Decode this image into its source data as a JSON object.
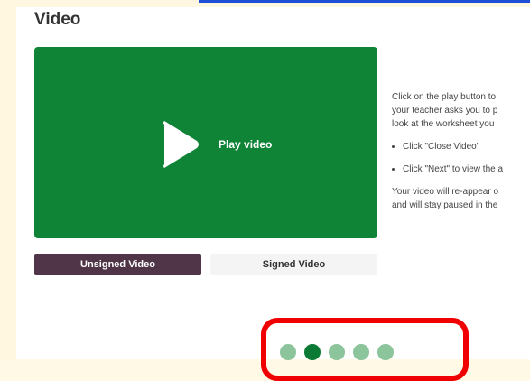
{
  "page": {
    "title": "Video"
  },
  "video": {
    "play_label": "Play video",
    "tabs": [
      {
        "label": "Unsigned Video",
        "active": true
      },
      {
        "label": "Signed Video",
        "active": false
      }
    ]
  },
  "instructions": {
    "line1": "Click on the play button to",
    "line2": "your teacher asks you to p",
    "line3": "look at the worksheet you",
    "bullet1": "Click \"Close Video\"",
    "bullet2": "Click \"Next\" to view the a",
    "line4": "Your video will re-appear o",
    "line5": "and will stay paused in the"
  },
  "pagination": {
    "total": 5,
    "current": 2
  },
  "colors": {
    "video_bg": "#0f8336",
    "active_tab": "#4f3547",
    "inactive_tab": "#f4f4f4",
    "highlight": "#f00000",
    "dot": "#8cc49b",
    "dot_current": "#0a7a34"
  }
}
